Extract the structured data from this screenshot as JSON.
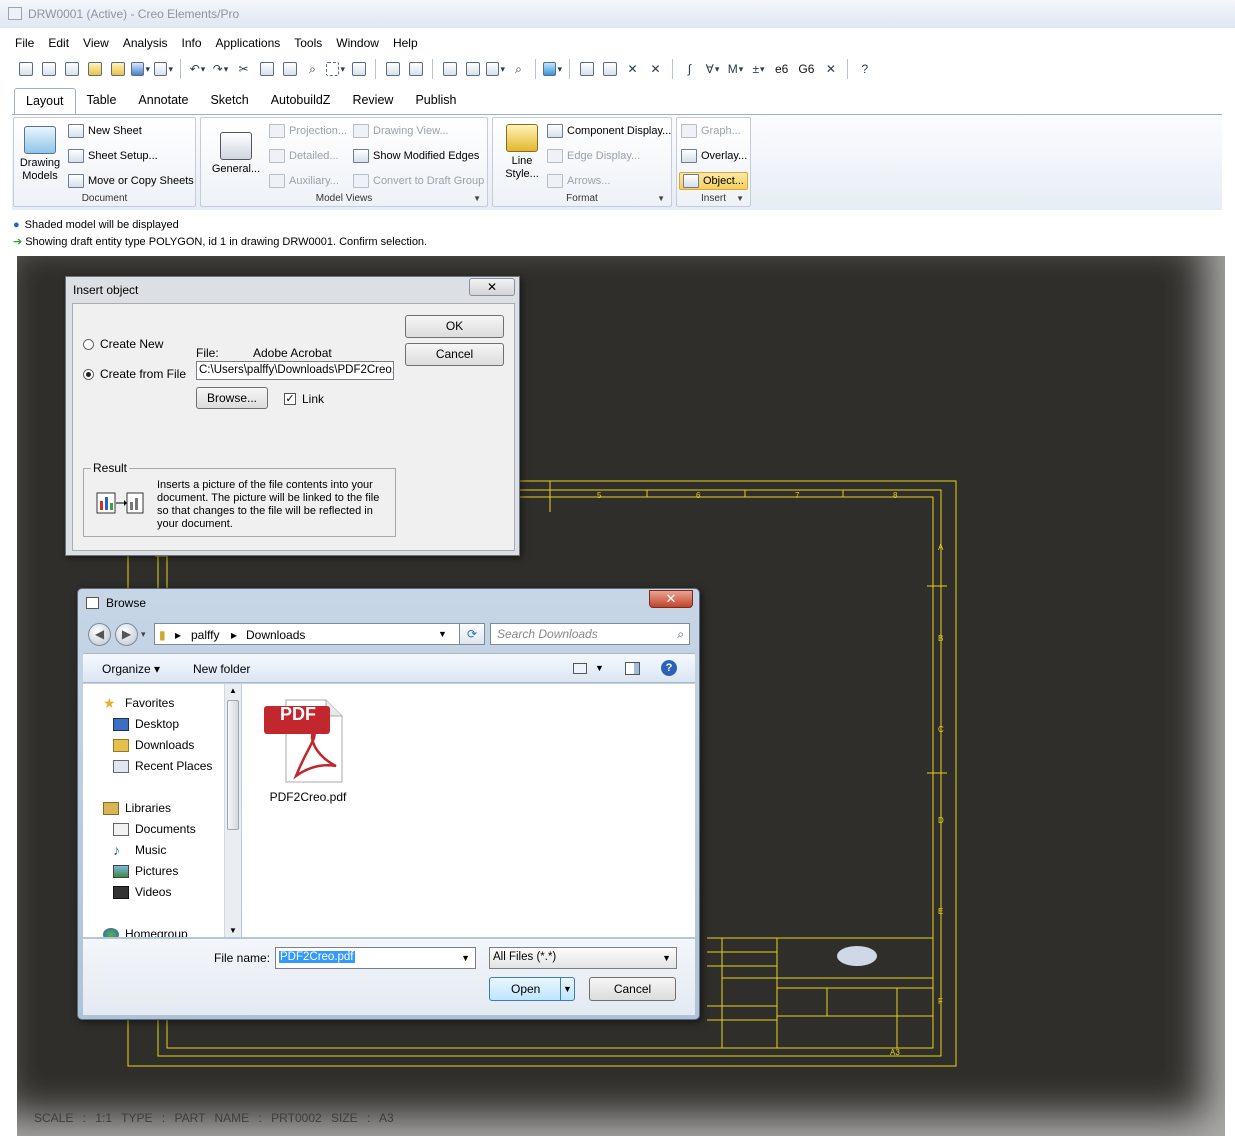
{
  "window": {
    "title": "DRW0001 (Active) - Creo Elements/Pro"
  },
  "menu": [
    "File",
    "Edit",
    "View",
    "Analysis",
    "Info",
    "Applications",
    "Tools",
    "Window",
    "Help"
  ],
  "toolbar": {
    "text_items": [
      "e6",
      "G6"
    ]
  },
  "ribbon": {
    "tabs": [
      "Layout",
      "Table",
      "Annotate",
      "Sketch",
      "AutobuildZ",
      "Review",
      "Publish"
    ],
    "active_tab": "Layout",
    "document": {
      "title": "Document",
      "drawing_models": "Drawing\nModels",
      "new_sheet": "New Sheet",
      "sheet_setup": "Sheet Setup...",
      "move_copy": "Move or Copy Sheets"
    },
    "model_views": {
      "title": "Model Views",
      "general": "General...",
      "projection": "Projection...",
      "detailed": "Detailed...",
      "auxiliary": "Auxiliary...",
      "drawing_view": "Drawing View...",
      "show_modified_edges": "Show Modified Edges",
      "convert_draft": "Convert to Draft Group"
    },
    "format": {
      "title": "Format",
      "line_style": "Line\nStyle...",
      "component_display": "Component Display...",
      "edge_display": "Edge Display...",
      "arrows": "Arrows..."
    },
    "insert": {
      "title": "Insert",
      "graph": "Graph...",
      "overlay": "Overlay...",
      "object": "Object..."
    }
  },
  "messages": [
    "Shaded model will be displayed",
    "Showing draft entity type POLYGON, id 1 in drawing DRW0001. Confirm selection."
  ],
  "drawing": {
    "zone_numbers": [
      "5",
      "6",
      "7",
      "8"
    ],
    "zone_letters": [
      "A",
      "B",
      "C",
      "D",
      "E",
      "F"
    ],
    "sheet_size": "A3",
    "status_line": "SCALE : 1:1     TYPE : PART     NAME : PRT0002     SIZE : A3"
  },
  "insert_object": {
    "title": "Insert object",
    "close": "✕",
    "create_new": "Create New",
    "create_from_file": "Create from File",
    "file_label": "File:",
    "file_app": "Adobe Acrobat",
    "file_path": "C:\\Users\\palffy\\Downloads\\PDF2Creo.pdf",
    "browse": "Browse...",
    "link": "Link",
    "ok": "OK",
    "cancel": "Cancel",
    "result_label": "Result",
    "result_text": "Inserts a picture of the file contents into your document.  The picture will be linked to the file so that changes to the file will be reflected in your document."
  },
  "browse": {
    "title": "Browse",
    "close": "✕",
    "path": [
      "palffy",
      "Downloads"
    ],
    "search_placeholder": "Search Downloads",
    "organize": "Organize ▾",
    "new_folder": "New folder",
    "nav": {
      "favorites": "Favorites",
      "desktop": "Desktop",
      "downloads": "Downloads",
      "recent": "Recent Places",
      "libraries": "Libraries",
      "documents": "Documents",
      "music": "Music",
      "pictures": "Pictures",
      "videos": "Videos",
      "homegroup": "Homegroup"
    },
    "file_name": "PDF2Creo.pdf",
    "file_badge": "PDF",
    "filename_label": "File name:",
    "filename_value": "PDF2Creo.pdf",
    "filetype": "All Files (*.*)",
    "open": "Open",
    "cancel": "Cancel"
  },
  "colors": {
    "drawing_lines": "#e6d21e",
    "canvas_bg": "#2f2e2a",
    "pdf_red": "#c1272d"
  }
}
